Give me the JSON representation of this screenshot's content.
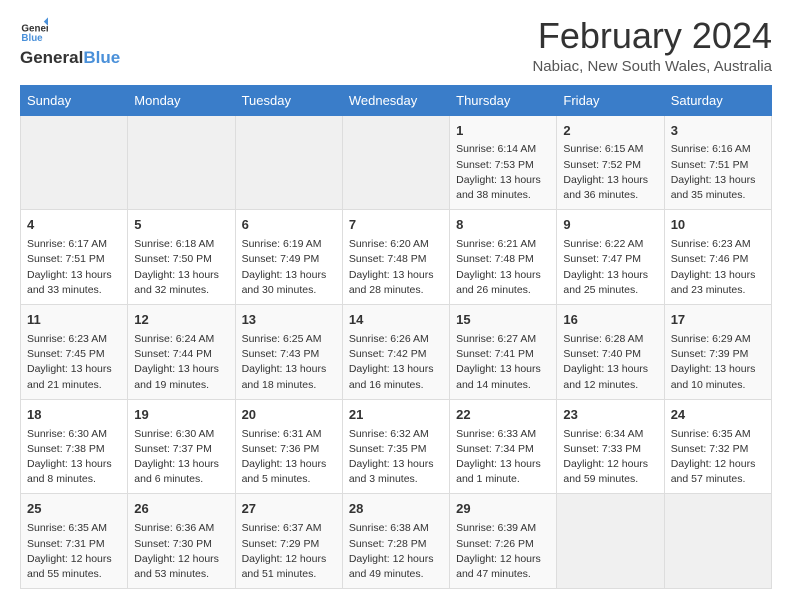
{
  "header": {
    "logo_general": "General",
    "logo_blue": "Blue",
    "title": "February 2024",
    "subtitle": "Nabiac, New South Wales, Australia"
  },
  "calendar": {
    "days_of_week": [
      "Sunday",
      "Monday",
      "Tuesday",
      "Wednesday",
      "Thursday",
      "Friday",
      "Saturday"
    ],
    "weeks": [
      [
        {
          "day": "",
          "content": ""
        },
        {
          "day": "",
          "content": ""
        },
        {
          "day": "",
          "content": ""
        },
        {
          "day": "",
          "content": ""
        },
        {
          "day": "1",
          "content": "Sunrise: 6:14 AM\nSunset: 7:53 PM\nDaylight: 13 hours and 38 minutes."
        },
        {
          "day": "2",
          "content": "Sunrise: 6:15 AM\nSunset: 7:52 PM\nDaylight: 13 hours and 36 minutes."
        },
        {
          "day": "3",
          "content": "Sunrise: 6:16 AM\nSunset: 7:51 PM\nDaylight: 13 hours and 35 minutes."
        }
      ],
      [
        {
          "day": "4",
          "content": "Sunrise: 6:17 AM\nSunset: 7:51 PM\nDaylight: 13 hours and 33 minutes."
        },
        {
          "day": "5",
          "content": "Sunrise: 6:18 AM\nSunset: 7:50 PM\nDaylight: 13 hours and 32 minutes."
        },
        {
          "day": "6",
          "content": "Sunrise: 6:19 AM\nSunset: 7:49 PM\nDaylight: 13 hours and 30 minutes."
        },
        {
          "day": "7",
          "content": "Sunrise: 6:20 AM\nSunset: 7:48 PM\nDaylight: 13 hours and 28 minutes."
        },
        {
          "day": "8",
          "content": "Sunrise: 6:21 AM\nSunset: 7:48 PM\nDaylight: 13 hours and 26 minutes."
        },
        {
          "day": "9",
          "content": "Sunrise: 6:22 AM\nSunset: 7:47 PM\nDaylight: 13 hours and 25 minutes."
        },
        {
          "day": "10",
          "content": "Sunrise: 6:23 AM\nSunset: 7:46 PM\nDaylight: 13 hours and 23 minutes."
        }
      ],
      [
        {
          "day": "11",
          "content": "Sunrise: 6:23 AM\nSunset: 7:45 PM\nDaylight: 13 hours and 21 minutes."
        },
        {
          "day": "12",
          "content": "Sunrise: 6:24 AM\nSunset: 7:44 PM\nDaylight: 13 hours and 19 minutes."
        },
        {
          "day": "13",
          "content": "Sunrise: 6:25 AM\nSunset: 7:43 PM\nDaylight: 13 hours and 18 minutes."
        },
        {
          "day": "14",
          "content": "Sunrise: 6:26 AM\nSunset: 7:42 PM\nDaylight: 13 hours and 16 minutes."
        },
        {
          "day": "15",
          "content": "Sunrise: 6:27 AM\nSunset: 7:41 PM\nDaylight: 13 hours and 14 minutes."
        },
        {
          "day": "16",
          "content": "Sunrise: 6:28 AM\nSunset: 7:40 PM\nDaylight: 13 hours and 12 minutes."
        },
        {
          "day": "17",
          "content": "Sunrise: 6:29 AM\nSunset: 7:39 PM\nDaylight: 13 hours and 10 minutes."
        }
      ],
      [
        {
          "day": "18",
          "content": "Sunrise: 6:30 AM\nSunset: 7:38 PM\nDaylight: 13 hours and 8 minutes."
        },
        {
          "day": "19",
          "content": "Sunrise: 6:30 AM\nSunset: 7:37 PM\nDaylight: 13 hours and 6 minutes."
        },
        {
          "day": "20",
          "content": "Sunrise: 6:31 AM\nSunset: 7:36 PM\nDaylight: 13 hours and 5 minutes."
        },
        {
          "day": "21",
          "content": "Sunrise: 6:32 AM\nSunset: 7:35 PM\nDaylight: 13 hours and 3 minutes."
        },
        {
          "day": "22",
          "content": "Sunrise: 6:33 AM\nSunset: 7:34 PM\nDaylight: 13 hours and 1 minute."
        },
        {
          "day": "23",
          "content": "Sunrise: 6:34 AM\nSunset: 7:33 PM\nDaylight: 12 hours and 59 minutes."
        },
        {
          "day": "24",
          "content": "Sunrise: 6:35 AM\nSunset: 7:32 PM\nDaylight: 12 hours and 57 minutes."
        }
      ],
      [
        {
          "day": "25",
          "content": "Sunrise: 6:35 AM\nSunset: 7:31 PM\nDaylight: 12 hours and 55 minutes."
        },
        {
          "day": "26",
          "content": "Sunrise: 6:36 AM\nSunset: 7:30 PM\nDaylight: 12 hours and 53 minutes."
        },
        {
          "day": "27",
          "content": "Sunrise: 6:37 AM\nSunset: 7:29 PM\nDaylight: 12 hours and 51 minutes."
        },
        {
          "day": "28",
          "content": "Sunrise: 6:38 AM\nSunset: 7:28 PM\nDaylight: 12 hours and 49 minutes."
        },
        {
          "day": "29",
          "content": "Sunrise: 6:39 AM\nSunset: 7:26 PM\nDaylight: 12 hours and 47 minutes."
        },
        {
          "day": "",
          "content": ""
        },
        {
          "day": "",
          "content": ""
        }
      ]
    ]
  }
}
